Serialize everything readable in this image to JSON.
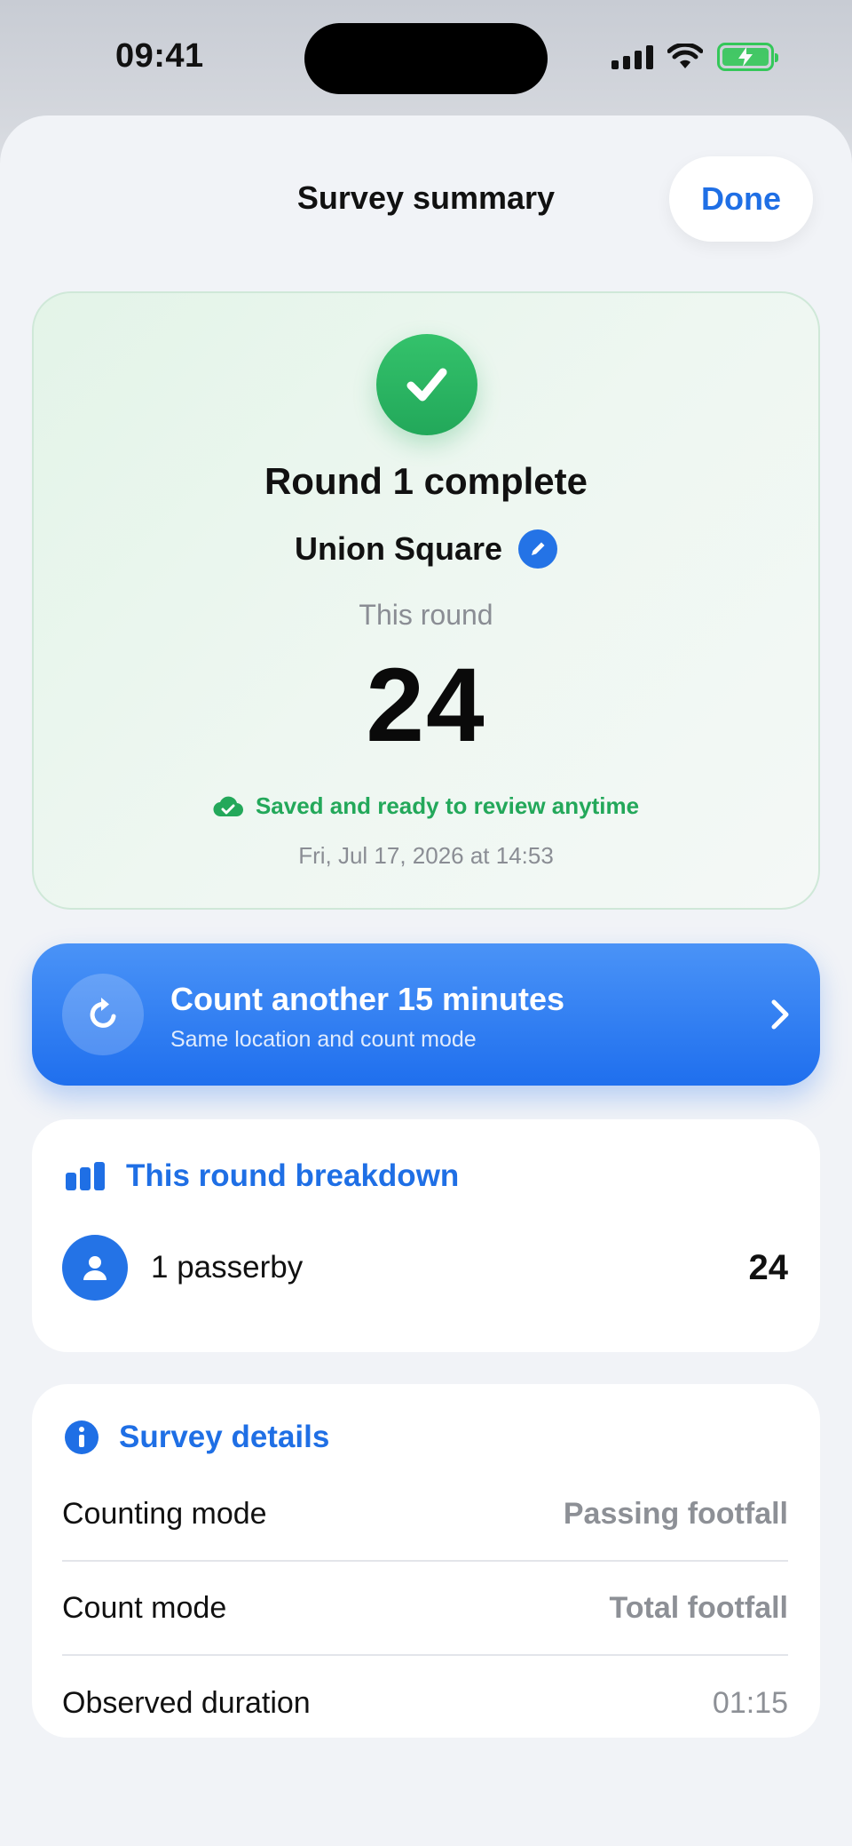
{
  "status_bar": {
    "time": "09:41",
    "icons": [
      "cellular-signal-icon",
      "wifi-icon",
      "battery-charging-icon"
    ]
  },
  "header": {
    "title": "Survey summary",
    "done_label": "Done"
  },
  "hero": {
    "icon": "checkmark-icon",
    "title": "Round 1 complete",
    "location": "Union Square",
    "round_caption": "This round",
    "round_count": "24",
    "saved_text": "Saved and ready to review anytime",
    "timestamp": "Fri, Jul 17, 2026 at 14:53"
  },
  "cta": {
    "title": "Count another 15 minutes",
    "subtitle": "Same location and count mode"
  },
  "breakdown": {
    "title": "This round breakdown",
    "rows": [
      {
        "label": "1 passerby",
        "value": "24"
      }
    ]
  },
  "details": {
    "title": "Survey details",
    "rows": [
      {
        "label": "Counting mode",
        "value": "Passing footfall"
      },
      {
        "label": "Count mode",
        "value": "Total footfall"
      },
      {
        "label": "Observed duration",
        "value": "01:15"
      }
    ]
  },
  "colors": {
    "accent_blue": "#1f6fe5",
    "success_green": "#23a85a",
    "battery_green": "#34c759"
  }
}
